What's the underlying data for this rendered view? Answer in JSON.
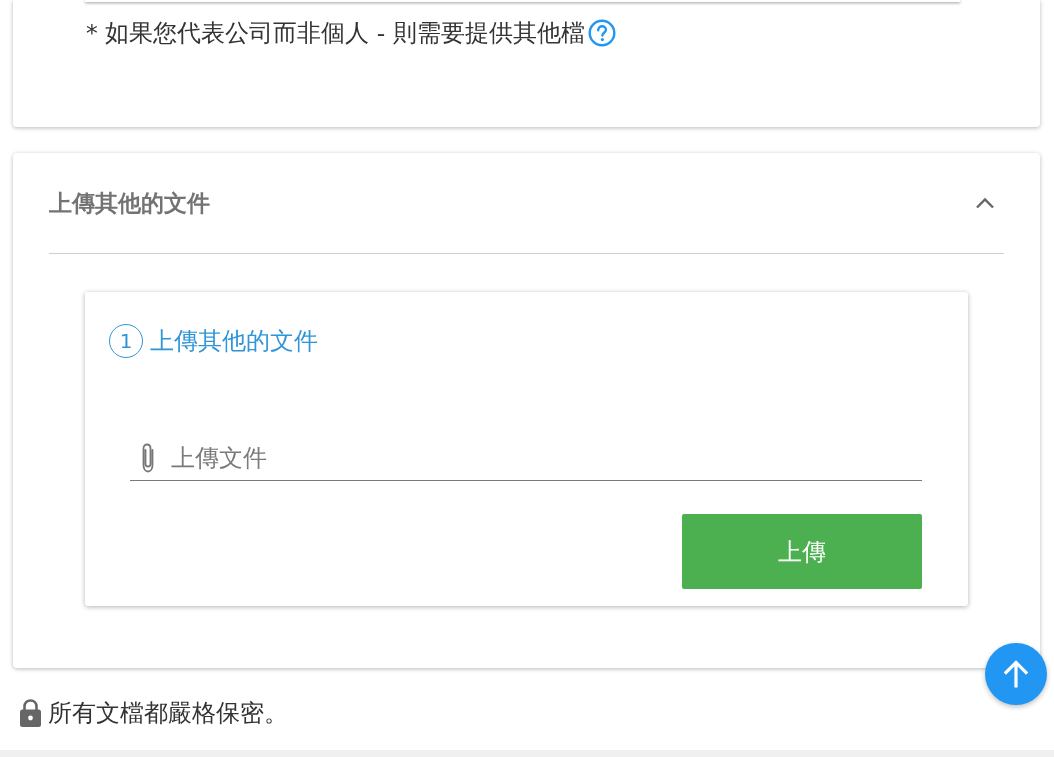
{
  "previous_card": {
    "note": "* 如果您代表公司而非個人 - 則需要提供其他檔"
  },
  "upload_panel": {
    "title": "上傳其他的文件",
    "expanded": true,
    "step": {
      "number": "1",
      "title": "上傳其他的文件"
    },
    "file_field": {
      "placeholder": "上傳文件"
    },
    "upload_button": "上傳"
  },
  "footer": {
    "text": "所有文檔都嚴格保密。"
  }
}
